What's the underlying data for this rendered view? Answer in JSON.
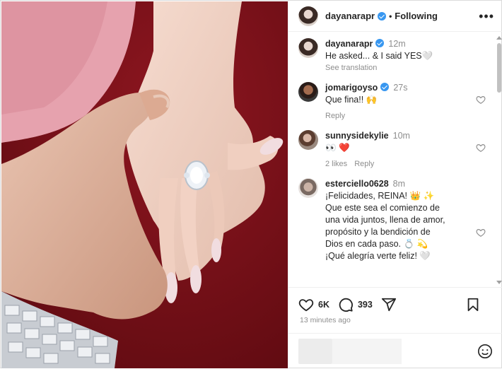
{
  "post": {
    "author": "dayanarapr",
    "follow_status": "Following",
    "more_label": "•••",
    "caption": {
      "username": "dayanarapr",
      "time": "12m",
      "text": "He asked... & I said YES🤍",
      "see_translation": "See translation"
    }
  },
  "comments": [
    {
      "username": "jomarigoyso",
      "verified": true,
      "time": "27s",
      "text": "Que fina!! 🙌",
      "likes": "",
      "reply": "Reply"
    },
    {
      "username": "sunnysidekylie",
      "verified": false,
      "time": "10m",
      "text": "👀 ❤️",
      "likes": "2 likes",
      "reply": "Reply"
    },
    {
      "username": "esterciello0628",
      "verified": false,
      "time": "8m",
      "text_lines": [
        "¡Felicidades, REINA! 👑 ✨",
        "Que este sea el comienzo de",
        "una vida juntos, llena de amor,",
        "propósito y la bendición de",
        "Dios en cada paso. 💍 💫",
        "¡Qué alegría verte feliz! 🤍"
      ]
    }
  ],
  "actions": {
    "likes_count": "6K",
    "comments_count": "393"
  },
  "timestamp": "13 minutes ago",
  "icons": {
    "like": "heart-icon",
    "comment": "comment-icon",
    "share": "share-icon",
    "save": "bookmark-icon",
    "emoji": "emoji-icon",
    "more": "more-icon"
  },
  "colors": {
    "accent": "#3897f0",
    "heart": "#e0245e",
    "muted": "#8e8e8e"
  }
}
